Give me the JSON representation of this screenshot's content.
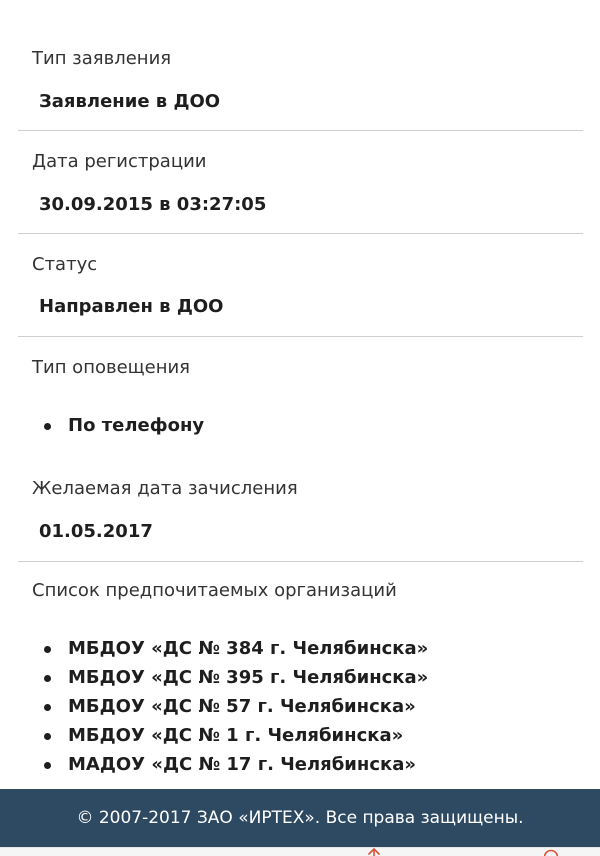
{
  "fields": {
    "application_type": {
      "label": "Тип заявления",
      "value": "Заявление в ДОО"
    },
    "registration_date": {
      "label": "Дата регистрации",
      "value": "30.09.2015 в 03:27:05"
    },
    "status": {
      "label": "Статус",
      "value": "Направлен в ДОО"
    },
    "notification_type": {
      "label": "Тип оповещения",
      "items": [
        "По телефону"
      ]
    },
    "desired_enrollment_date": {
      "label": "Желаемая дата зачисления",
      "value": "01.05.2017"
    },
    "preferred_organizations": {
      "label": "Список предпочитаемых организаций",
      "items": [
        "МБДОУ «ДС № 384 г. Челябинска»",
        "МБДОУ «ДС № 395 г. Челябинска»",
        "МБДОУ «ДС № 57 г. Челябинска»",
        "МБДОУ «ДС № 1 г. Челябинска»",
        "МАДОУ «ДС № 17 г. Челябинска»"
      ]
    }
  },
  "footer": {
    "text": "© 2007-2017 ЗАО «ИРТЕХ». Все права защищены."
  },
  "icons": {
    "upload": "upload-icon",
    "circle": "circle-icon"
  },
  "colors": {
    "footer_bg": "#2e4a63",
    "accent": "#d9533a",
    "divider": "#cfcfcf"
  }
}
